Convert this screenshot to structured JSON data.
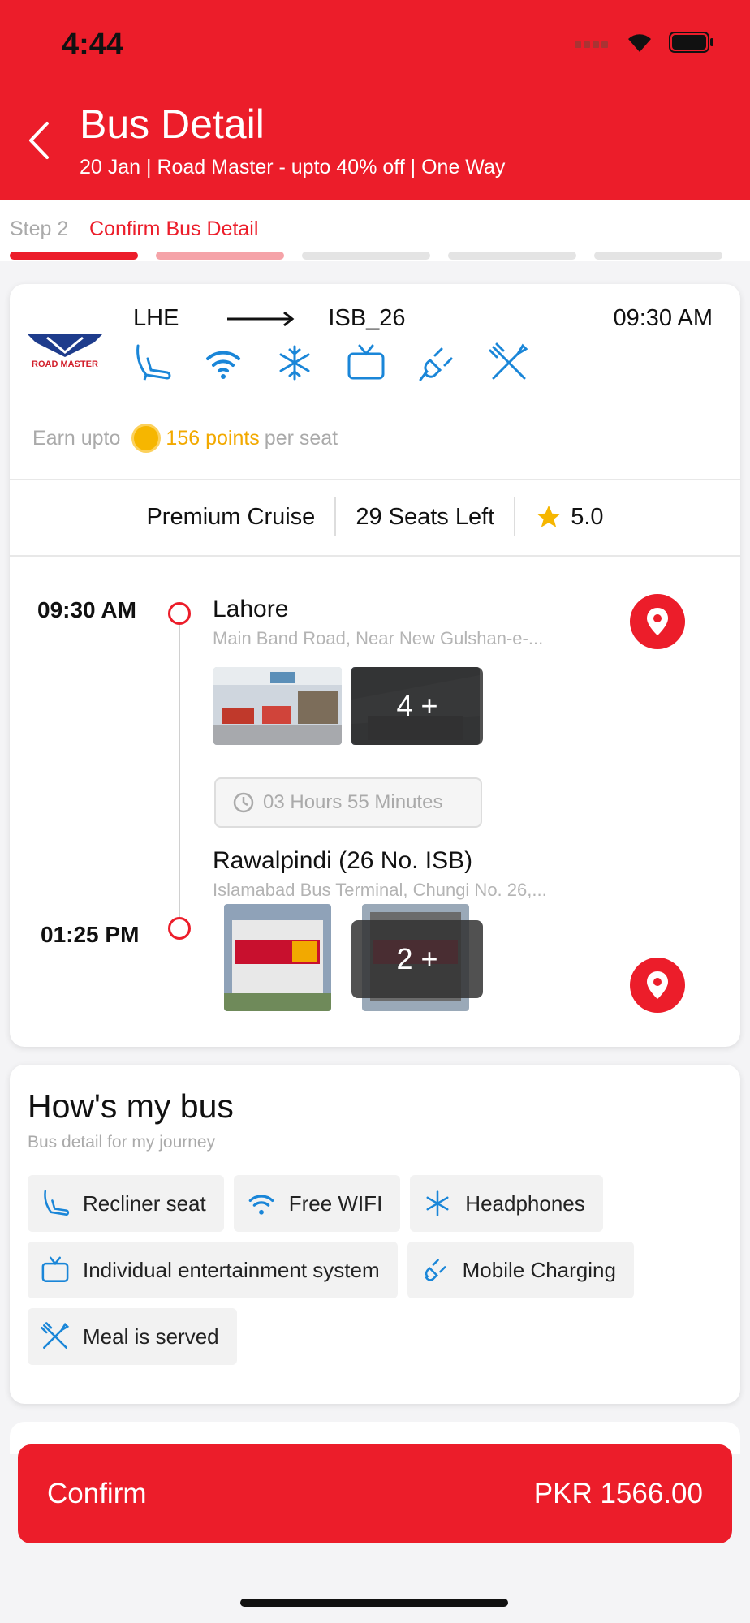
{
  "status": {
    "time": "4:44"
  },
  "header": {
    "title": "Bus Detail",
    "subtitle": "20 Jan | Road Master - upto 40% off | One Way"
  },
  "steps": {
    "step_label": "Step 2",
    "step_name": "Confirm Bus Detail",
    "total": 5,
    "current": 2
  },
  "bus": {
    "operator_logo_text": "ROAD MASTER",
    "from": "LHE",
    "to": "ISB_26",
    "departure_time": "09:30 AM",
    "amenity_icons": [
      "recliner-seat-icon",
      "wifi-icon",
      "snowflake-icon",
      "tv-icon",
      "charging-icon",
      "meal-icon"
    ],
    "points_prefix": "Earn upto",
    "points_value": "156 points",
    "points_suffix": "per seat",
    "class": "Premium Cruise",
    "seats_left": "29 Seats Left",
    "rating": "5.0"
  },
  "timeline": {
    "origin": {
      "time": "09:30 AM",
      "city": "Lahore",
      "address": "Main Band Road, Near New Gulshan-e-...",
      "more_photos": "4 +"
    },
    "duration": "03 Hours 55 Minutes",
    "destination": {
      "time": "01:25 PM",
      "city": "Rawalpindi (26 No. ISB)",
      "address": "Islamabad Bus Terminal, Chungi No. 26,...",
      "more_photos": "2 +"
    }
  },
  "hows_my_bus": {
    "title": "How's my bus",
    "subtitle": "Bus detail for my journey",
    "amenities": [
      {
        "label": "Recliner seat",
        "icon": "recliner-seat-icon"
      },
      {
        "label": "Free WIFI",
        "icon": "wifi-icon"
      },
      {
        "label": "Headphones",
        "icon": "snowflake-icon"
      },
      {
        "label": "Individual entertainment system",
        "icon": "tv-icon"
      },
      {
        "label": "Mobile Charging",
        "icon": "charging-icon"
      },
      {
        "label": "Meal is served",
        "icon": "meal-icon"
      }
    ]
  },
  "footer": {
    "confirm_label": "Confirm",
    "price": "PKR 1566.00"
  },
  "colors": {
    "accent": "#ec1d2a",
    "icon_blue": "#1a86d8",
    "points_gold": "#f2a900"
  }
}
